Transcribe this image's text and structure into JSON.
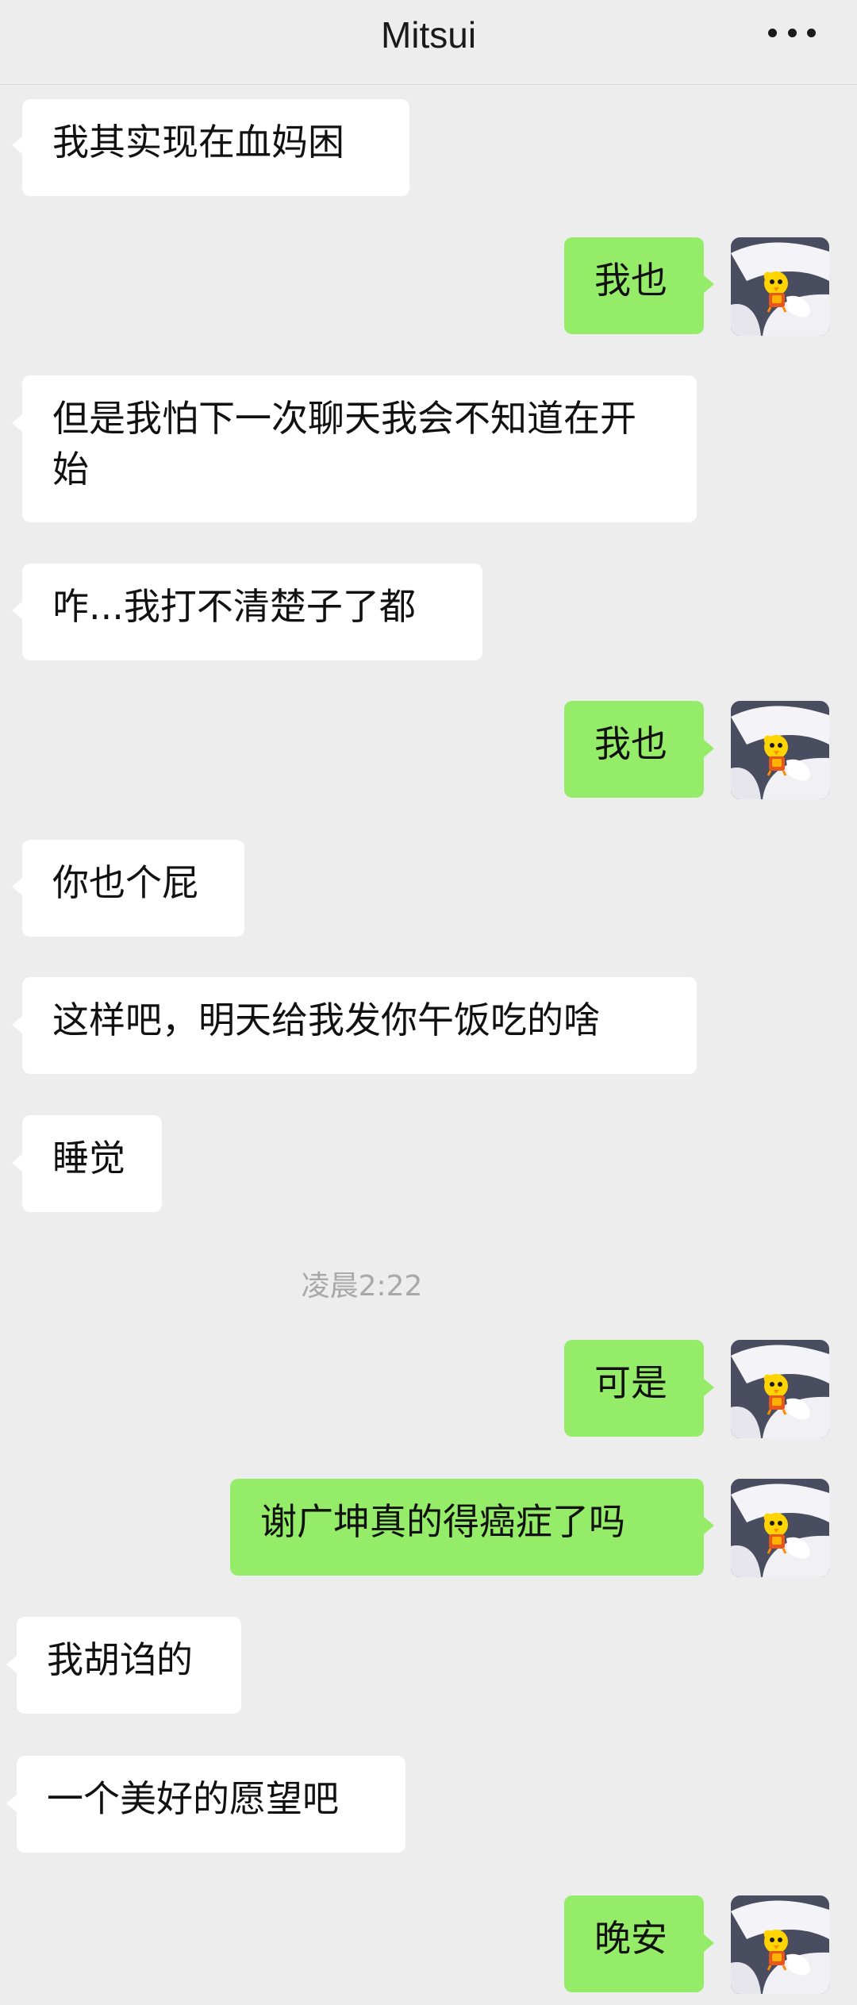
{
  "header": {
    "title": "Mitsui",
    "more_icon": "more-dots-icon"
  },
  "messages": [
    {
      "side": "left",
      "text": "我其实现在血妈困"
    },
    {
      "side": "right",
      "text": "我也"
    },
    {
      "side": "left",
      "text": "但是我怕下一次聊天我会不知道在开始"
    },
    {
      "side": "left",
      "text": "咋...我打不清楚子了都"
    },
    {
      "side": "right",
      "text": "我也"
    },
    {
      "side": "left",
      "text": "你也个屁"
    },
    {
      "side": "left",
      "text": "这样吧，明天给我发你午饭吃的啥"
    },
    {
      "side": "left",
      "text": "睡觉"
    },
    {
      "side": "right",
      "text": "可是"
    },
    {
      "side": "right",
      "text": "谢广坤真的得癌症了吗"
    },
    {
      "side": "left",
      "text": "我胡诌的"
    },
    {
      "side": "left",
      "text": "一个美好的愿望吧"
    },
    {
      "side": "right",
      "text": "晚安"
    }
  ],
  "timestamp": "凌晨2:22",
  "colors": {
    "background": "#ededed",
    "left_bubble": "#ffffff",
    "right_bubble": "#95ec69"
  },
  "avatar_icon": "cartoon-bird-avatar-icon"
}
